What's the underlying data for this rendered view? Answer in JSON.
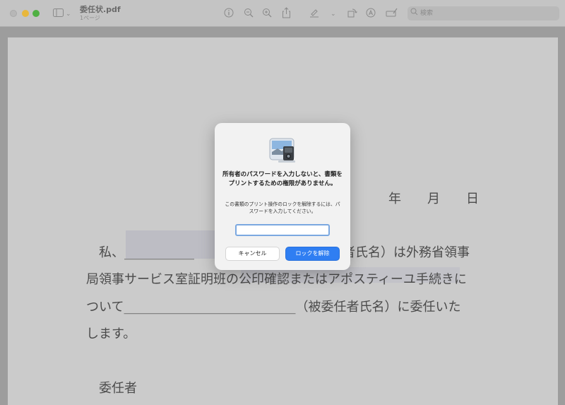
{
  "window": {
    "title": "委任状.pdf",
    "subtitle": "1ページ"
  },
  "toolbar": {
    "icons": [
      "sidebar-icon",
      "chevron-down-icon",
      "info-icon",
      "zoom-out-icon",
      "zoom-in-icon",
      "share-icon",
      "highlight-pen-icon",
      "chevron-down-icon",
      "rotate-icon",
      "markup-icon",
      "form-fill-icon"
    ],
    "search_placeholder": "検索"
  },
  "document": {
    "date_year": "年",
    "date_month": "月",
    "date_day": "日",
    "line1_start": "私、___________",
    "line1_end": "者氏名）は外務省領事",
    "line2": "局領事サービス室証明班の公印確認またはアポスティーユ手続きに",
    "line3": "ついて___________________________（被委任者氏名）に委任いた",
    "line4": "します。",
    "delegator_label": "委任者"
  },
  "dialog": {
    "title": "所有者のパスワードを入力しないと、書類をプリントするための権限がありません。",
    "message": "この書類のプリント操作のロックを解除するには、パスワードを入力してください。",
    "password_value": "",
    "cancel_label": "キャンセル",
    "unlock_label": "ロックを解除",
    "accent_color": "#2f7ef2"
  }
}
